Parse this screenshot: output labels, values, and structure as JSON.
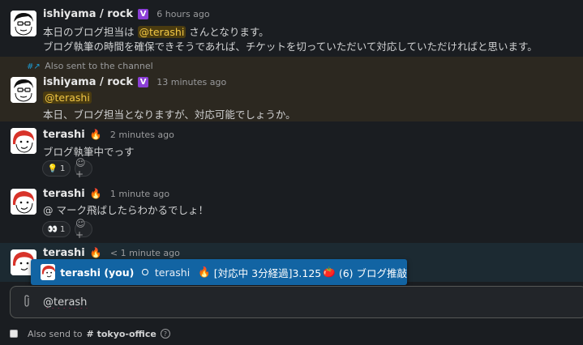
{
  "messages": [
    {
      "author": "ishiyama / rock",
      "badge": "V",
      "time": "6 hours ago",
      "line1_pre": "本日のブログ担当は",
      "mention": "@terashi",
      "line1_post": "さんとなります。",
      "line2": "ブログ執筆の時間を確保できそうであれば、チケットを切っていただいて対応していただければと思います。"
    },
    {
      "also_sent": "Also sent to the channel",
      "author": "ishiyama / rock",
      "badge": "V",
      "time": "13 minutes ago",
      "mention": "@terashi",
      "line2": "本日、ブログ担当となりますが、対応可能でしょうか。"
    },
    {
      "author": "terashi",
      "time": "2 minutes ago",
      "text": "ブログ執筆中でっす",
      "reaction_emoji": "💡",
      "reaction_count": "1"
    },
    {
      "author": "terashi",
      "time": "1 minute ago",
      "text": "@ マーク飛ばしたらわかるでしょ！",
      "reaction_emoji": "👀",
      "reaction_count": "1"
    },
    {
      "author": "terashi",
      "time": "< 1 minute ago"
    }
  ],
  "autocomplete": {
    "name": "terashi (you)",
    "handle": "terashi",
    "status": "[対応中 3分経過]3.125",
    "status_tail": "(6) ブログ推敲"
  },
  "composer": {
    "value": "@terash",
    "also_send_label": "Also send to",
    "channel": "# tokyo-office",
    "help": "?"
  },
  "colors": {
    "background": "#1a1d21",
    "highlight_bg": "#2c2820",
    "mention_bg": "#4a3b10",
    "mention_fg": "#f2c744",
    "autocomplete_bg": "#1264a3",
    "badge": "#8b3fd6"
  }
}
